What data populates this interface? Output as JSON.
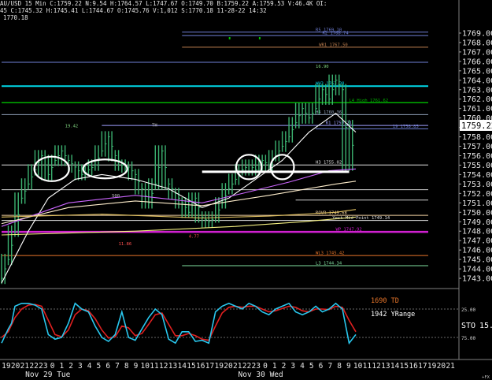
{
  "header": {
    "line1": "AU/USD  15 Min  C:1759.22  N:9.54  H:1764.57  L:1747.67  O:1749.70  B:1759.22  A:1759.53  V:46.4K  OI:",
    "line2": "45  C:1745.32  H:1745.41  L:1744.67  O:1745.76  V:1,012  S:1770.18  11-28-22  14:32",
    "line3": "1770.18"
  },
  "colors": {
    "background": "#000000",
    "price_bars": "#3cb371",
    "last_price_box": "#ffffff",
    "stoch_k": "#29c7ee",
    "stoch_d": "#e02020"
  },
  "chart_data": {
    "type": "line",
    "price_panel": {
      "ylim": [
        1742,
        1770
      ],
      "y_ticks": [
        "1769.00",
        "1768.00",
        "1767.00",
        "1766.00",
        "1765.00",
        "1764.00",
        "1763.00",
        "1762.00",
        "1761.00",
        "1760.00",
        "1759.00",
        "1758.00",
        "1757.00",
        "1756.00",
        "1755.00",
        "1754.00",
        "1753.00",
        "1752.00",
        "1751.00",
        "1750.00",
        "1749.00",
        "1748.00",
        "1747.00",
        "1746.00",
        "1745.00",
        "1744.00",
        "1743.00"
      ],
      "last_price": "1759.22",
      "price_series": [
        [
          0,
          1743.0
        ],
        [
          2,
          1745.0
        ],
        [
          4,
          1748.0
        ],
        [
          6,
          1751.5
        ],
        [
          8,
          1753.0
        ],
        [
          10,
          1754.5
        ],
        [
          12,
          1756.0
        ],
        [
          14,
          1754.0
        ],
        [
          16,
          1755.5
        ],
        [
          18,
          1756.5
        ],
        [
          20,
          1755.5
        ],
        [
          22,
          1754.8
        ],
        [
          24,
          1754.0
        ],
        [
          26,
          1754.5
        ],
        [
          28,
          1755.0
        ],
        [
          30,
          1756.5
        ],
        [
          32,
          1758.0
        ],
        [
          34,
          1756.0
        ],
        [
          36,
          1755.0
        ],
        [
          38,
          1754.8
        ],
        [
          40,
          1754.0
        ],
        [
          42,
          1752.5
        ],
        [
          44,
          1751.0
        ],
        [
          46,
          1753.0
        ],
        [
          48,
          1756.5
        ],
        [
          50,
          1753.0
        ],
        [
          52,
          1752.0
        ],
        [
          54,
          1751.0
        ],
        [
          56,
          1750.0
        ],
        [
          58,
          1751.5
        ],
        [
          60,
          1749.5
        ],
        [
          62,
          1749.0
        ],
        [
          64,
          1749.5
        ],
        [
          66,
          1751.0
        ],
        [
          68,
          1752.5
        ],
        [
          70,
          1753.5
        ],
        [
          72,
          1754.5
        ],
        [
          74,
          1755.0
        ],
        [
          76,
          1754.5
        ],
        [
          78,
          1755.5
        ],
        [
          80,
          1755.0
        ],
        [
          82,
          1756.0
        ],
        [
          84,
          1757.0
        ],
        [
          86,
          1758.0
        ],
        [
          88,
          1759.5
        ],
        [
          90,
          1761.0
        ],
        [
          92,
          1760.0
        ],
        [
          94,
          1761.0
        ],
        [
          96,
          1763.0
        ],
        [
          98,
          1762.0
        ],
        [
          100,
          1764.0
        ],
        [
          102,
          1763.0
        ],
        [
          104,
          1755.0
        ],
        [
          106,
          1759.2
        ]
      ],
      "ma_series": [
        {
          "name": "ma1",
          "color": "#ffffff",
          "points": [
            [
              0,
              1742.5
            ],
            [
              8,
              1748.0
            ],
            [
              14,
              1751.5
            ],
            [
              22,
              1753.5
            ],
            [
              30,
              1754.0
            ],
            [
              40,
              1753.5
            ],
            [
              50,
              1752.5
            ],
            [
              60,
              1750.5
            ],
            [
              68,
              1751.5
            ],
            [
              76,
              1753.5
            ],
            [
              84,
              1755.5
            ],
            [
              92,
              1758.5
            ],
            [
              100,
              1760.5
            ],
            [
              106,
              1758.5
            ]
          ]
        },
        {
          "name": "ma2",
          "color": "#cc66ff",
          "points": [
            [
              0,
              1748.5
            ],
            [
              20,
              1751.0
            ],
            [
              40,
              1751.8
            ],
            [
              60,
              1751.0
            ],
            [
              72,
              1752.0
            ],
            [
              86,
              1753.2
            ],
            [
              98,
              1754.4
            ],
            [
              106,
              1754.6
            ]
          ]
        },
        {
          "name": "ma3",
          "color": "#ffeecc",
          "points": [
            [
              0,
              1748.8
            ],
            [
              20,
              1750.5
            ],
            [
              40,
              1751.2
            ],
            [
              60,
              1750.7
            ],
            [
              80,
              1751.8
            ],
            [
              100,
              1753.0
            ],
            [
              106,
              1753.3
            ]
          ]
        },
        {
          "name": "ma4",
          "color": "#e0c060",
          "points": [
            [
              0,
              1749.5
            ],
            [
              30,
              1749.8
            ],
            [
              60,
              1749.4
            ],
            [
              80,
              1749.6
            ],
            [
              100,
              1750.0
            ],
            [
              106,
              1750.3
            ]
          ]
        },
        {
          "name": "ma5",
          "color": "#f2ee80",
          "points": [
            [
              0,
              1747.6
            ],
            [
              40,
              1748.0
            ],
            [
              70,
              1748.5
            ],
            [
              90,
              1749.0
            ],
            [
              106,
              1749.5
            ]
          ]
        }
      ],
      "levels": [
        {
          "label": "R5 1769.10",
          "price": 1769.1,
          "color": "#6f7fd6",
          "x_from": 54,
          "label_x": 94
        },
        {
          "label": "R2 1768.74",
          "price": 1768.74,
          "color": "#6f7fd6",
          "x_from": 54,
          "label_x": 96
        },
        {
          "label": "WR1 1767.50",
          "price": 1767.5,
          "color": "#c08050",
          "x_from": 54,
          "label_x": 95
        },
        {
          "label": "",
          "price": 1765.9,
          "color": "#6f7fd6",
          "x_from": 0,
          "label_x": 0
        },
        {
          "label": "WH3 1763.38",
          "price": 1763.38,
          "color": "#00d8e8",
          "x_from": 0,
          "label_x": 94,
          "width": 2
        },
        {
          "label": "L4 High 1761.62",
          "price": 1761.62,
          "color": "#00b000",
          "x_from": 0,
          "label_x": 104,
          "width": 1.5
        },
        {
          "label": "H4 1760.36",
          "price": 1760.36,
          "color": "#90a0b8",
          "x_from": 0,
          "label_x": 94
        },
        {
          "label": "R1 1759.21",
          "price": 1759.21,
          "color": "#a0a0ff",
          "x_from": 30,
          "label_x": 97
        },
        {
          "label": "19 1758.85",
          "price": 1758.85,
          "color": "#6f7fd6",
          "x_from": 94,
          "label_x": 117
        },
        {
          "label": "H3 1755.02",
          "price": 1755.02,
          "color": "#e0e0e0",
          "x_from": 0,
          "label_x": 94
        },
        {
          "label": "",
          "price": 1752.4,
          "color": "#d0d0d0",
          "x_from": 0,
          "label_x": 0
        },
        {
          "label": "",
          "price": 1751.3,
          "color": "#d0d0d0",
          "x_from": 88,
          "label_x": 0
        },
        {
          "label": "ROVR 1749.68",
          "price": 1749.68,
          "color": "#f0d0a0",
          "x_from": 0,
          "label_x": 94
        },
        {
          "label": "Yest Mid Point 1749.14",
          "price": 1749.14,
          "color": "#e0e0e0",
          "x_from": 0,
          "label_x": 99
        },
        {
          "label": "WP 1747.92",
          "price": 1747.92,
          "color": "#d020d0",
          "x_from": 0,
          "label_x": 100,
          "width": 2.5
        },
        {
          "label": "WL3 1745.42",
          "price": 1745.42,
          "color": "#e8762a",
          "x_from": 0,
          "label_x": 94
        },
        {
          "label": "L3 1744.34",
          "price": 1744.34,
          "color": "#80e0a0",
          "x_from": 54,
          "label_x": 94
        }
      ],
      "annotations": [
        {
          "text": "19.42",
          "x": 19,
          "y": 1759.0,
          "color": "#7fd37f"
        },
        {
          "text": "16.90",
          "x": 94,
          "y": 1765.3,
          "color": "#7fd37f"
        },
        {
          "text": "11.86",
          "x": 35,
          "y": 1746.5,
          "color": "#ff5050"
        },
        {
          "text": "4.77",
          "x": 56,
          "y": 1747.3,
          "color": "#ff5050"
        },
        {
          "text": "500",
          "x": 33,
          "y": 1751.6,
          "color": "#c0c0c0"
        },
        {
          "text": "TH",
          "x": 45,
          "y": 1759.1,
          "color": "#c0c0c0"
        }
      ],
      "ellipses": [
        {
          "cx": 15,
          "cy": 1754.6,
          "rx": 5.2,
          "ry": 1.3
        },
        {
          "cx": 31,
          "cy": 1754.6,
          "rx": 6.6,
          "ry": 1.0
        },
        {
          "cx": 74,
          "cy": 1754.8,
          "rx": 3.8,
          "ry": 1.3
        },
        {
          "cx": 84,
          "cy": 1754.8,
          "rx": 3.5,
          "ry": 1.3
        }
      ],
      "support_line": {
        "price": 1754.3,
        "x_from": 60,
        "x_to": 104
      }
    },
    "oscillator_panel": {
      "label": "STO",
      "value": "15.",
      "y_ticks": [
        "25.00",
        "75.00"
      ],
      "td_text": "1690 TD",
      "range_text": "1942 YRange",
      "k": [
        [
          0,
          85
        ],
        [
          2,
          60
        ],
        [
          3,
          50
        ],
        [
          4,
          20
        ],
        [
          6,
          15
        ],
        [
          8,
          15
        ],
        [
          10,
          18
        ],
        [
          12,
          25
        ],
        [
          14,
          70
        ],
        [
          16,
          78
        ],
        [
          18,
          75
        ],
        [
          20,
          50
        ],
        [
          22,
          15
        ],
        [
          24,
          25
        ],
        [
          26,
          30
        ],
        [
          28,
          55
        ],
        [
          30,
          75
        ],
        [
          32,
          82
        ],
        [
          34,
          70
        ],
        [
          36,
          30
        ],
        [
          38,
          75
        ],
        [
          40,
          80
        ],
        [
          42,
          60
        ],
        [
          44,
          40
        ],
        [
          46,
          25
        ],
        [
          48,
          35
        ],
        [
          50,
          78
        ],
        [
          52,
          85
        ],
        [
          54,
          65
        ],
        [
          56,
          65
        ],
        [
          58,
          82
        ],
        [
          60,
          80
        ],
        [
          62,
          85
        ],
        [
          64,
          30
        ],
        [
          66,
          20
        ],
        [
          68,
          15
        ],
        [
          70,
          20
        ],
        [
          72,
          25
        ],
        [
          74,
          15
        ],
        [
          76,
          20
        ],
        [
          78,
          30
        ],
        [
          80,
          35
        ],
        [
          82,
          25
        ],
        [
          84,
          20
        ],
        [
          86,
          15
        ],
        [
          88,
          30
        ],
        [
          90,
          35
        ],
        [
          92,
          30
        ],
        [
          94,
          20
        ],
        [
          96,
          30
        ],
        [
          98,
          25
        ],
        [
          100,
          15
        ],
        [
          102,
          25
        ],
        [
          104,
          85
        ],
        [
          106,
          70
        ]
      ],
      "d": [
        [
          0,
          75
        ],
        [
          2,
          65
        ],
        [
          4,
          40
        ],
        [
          6,
          25
        ],
        [
          8,
          18
        ],
        [
          10,
          17
        ],
        [
          12,
          20
        ],
        [
          14,
          45
        ],
        [
          16,
          70
        ],
        [
          18,
          74
        ],
        [
          20,
          62
        ],
        [
          22,
          35
        ],
        [
          24,
          25
        ],
        [
          26,
          28
        ],
        [
          28,
          42
        ],
        [
          30,
          62
        ],
        [
          32,
          76
        ],
        [
          34,
          74
        ],
        [
          36,
          55
        ],
        [
          38,
          58
        ],
        [
          40,
          72
        ],
        [
          42,
          68
        ],
        [
          44,
          52
        ],
        [
          46,
          35
        ],
        [
          48,
          32
        ],
        [
          50,
          52
        ],
        [
          52,
          72
        ],
        [
          54,
          72
        ],
        [
          56,
          68
        ],
        [
          58,
          72
        ],
        [
          60,
          78
        ],
        [
          62,
          80
        ],
        [
          64,
          55
        ],
        [
          66,
          32
        ],
        [
          68,
          22
        ],
        [
          70,
          20
        ],
        [
          72,
          22
        ],
        [
          74,
          20
        ],
        [
          76,
          20
        ],
        [
          78,
          25
        ],
        [
          80,
          30
        ],
        [
          82,
          28
        ],
        [
          84,
          24
        ],
        [
          86,
          20
        ],
        [
          88,
          22
        ],
        [
          90,
          28
        ],
        [
          92,
          30
        ],
        [
          94,
          25
        ],
        [
          96,
          25
        ],
        [
          98,
          26
        ],
        [
          100,
          20
        ],
        [
          102,
          22
        ],
        [
          104,
          45
        ],
        [
          106,
          65
        ]
      ]
    },
    "x_axis": {
      "bar_range": [
        0,
        106
      ],
      "hour_labels": [
        "19",
        "20",
        "21",
        "22",
        "23",
        "0",
        "1",
        "2",
        "3",
        "4",
        "5",
        "6",
        "7",
        "8",
        "9",
        "10",
        "11",
        "12",
        "13",
        "14",
        "15",
        "16",
        "17",
        "19",
        "20",
        "21",
        "22",
        "23",
        "0",
        "1",
        "2",
        "3",
        "4",
        "5",
        "6",
        "7",
        "8",
        "9",
        "10",
        "11",
        "12",
        "13",
        "14",
        "15",
        "16",
        "17",
        "19",
        "20",
        "21"
      ],
      "date_labels": [
        {
          "text": "Nov 29  Tue",
          "hour_index": 5
        },
        {
          "text": "Nov 30  Wed",
          "hour_index": 28
        }
      ],
      "corner_label": "+FX"
    }
  }
}
